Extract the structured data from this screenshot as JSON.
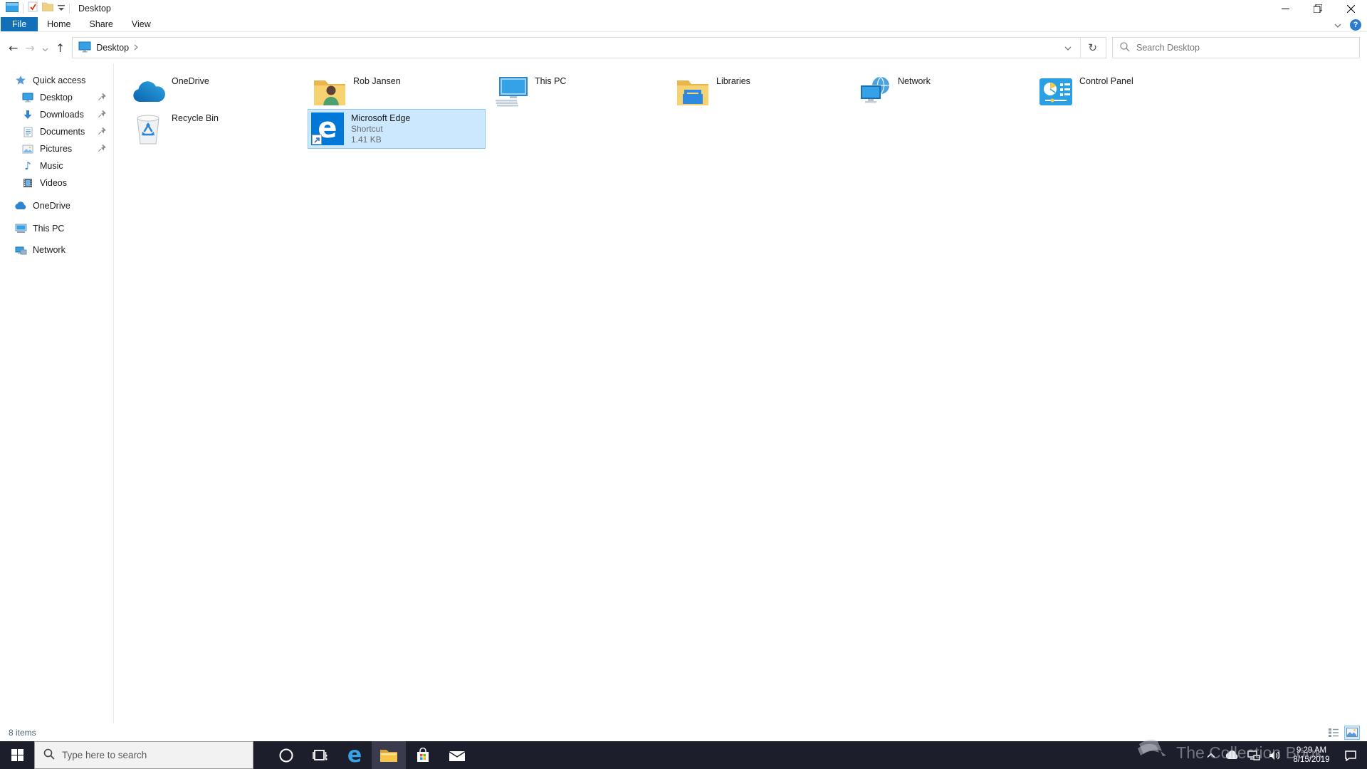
{
  "titlebar": {
    "title": "Desktop"
  },
  "ribbon": {
    "tabs": [
      "File",
      "Home",
      "Share",
      "View"
    ],
    "active_tab": "File",
    "help_label": "?"
  },
  "navbar": {
    "breadcrumb_root": "Desktop",
    "search_placeholder": "Search Desktop"
  },
  "sidebar": {
    "quick_access": {
      "label": "Quick access",
      "items": [
        {
          "label": "Desktop",
          "pinned": true
        },
        {
          "label": "Downloads",
          "pinned": true
        },
        {
          "label": "Documents",
          "pinned": true
        },
        {
          "label": "Pictures",
          "pinned": true
        },
        {
          "label": "Music",
          "pinned": false
        },
        {
          "label": "Videos",
          "pinned": false
        }
      ]
    },
    "roots": [
      {
        "label": "OneDrive"
      },
      {
        "label": "This PC"
      },
      {
        "label": "Network"
      }
    ]
  },
  "files": {
    "items": [
      {
        "label": "OneDrive"
      },
      {
        "label": "Rob Jansen"
      },
      {
        "label": "This PC"
      },
      {
        "label": "Libraries"
      },
      {
        "label": "Network"
      },
      {
        "label": "Control Panel"
      },
      {
        "label": "Recycle Bin"
      },
      {
        "label": "Microsoft Edge",
        "type": "Shortcut",
        "size": "1.41 KB",
        "selected": true
      }
    ]
  },
  "statusbar": {
    "item_count": "8 items"
  },
  "taskbar": {
    "search_placeholder": "Type here to search",
    "clock_time": "9:29 AM",
    "clock_date": "8/15/2019"
  },
  "watermark": {
    "text": "The Collection Book"
  },
  "colors": {
    "accent_blue": "#1270b8",
    "selection_bg": "#cce8ff",
    "selection_border": "#8fc7f2",
    "taskbar_bg": "#1d1e2c",
    "edge_blue": "#0078d7"
  }
}
